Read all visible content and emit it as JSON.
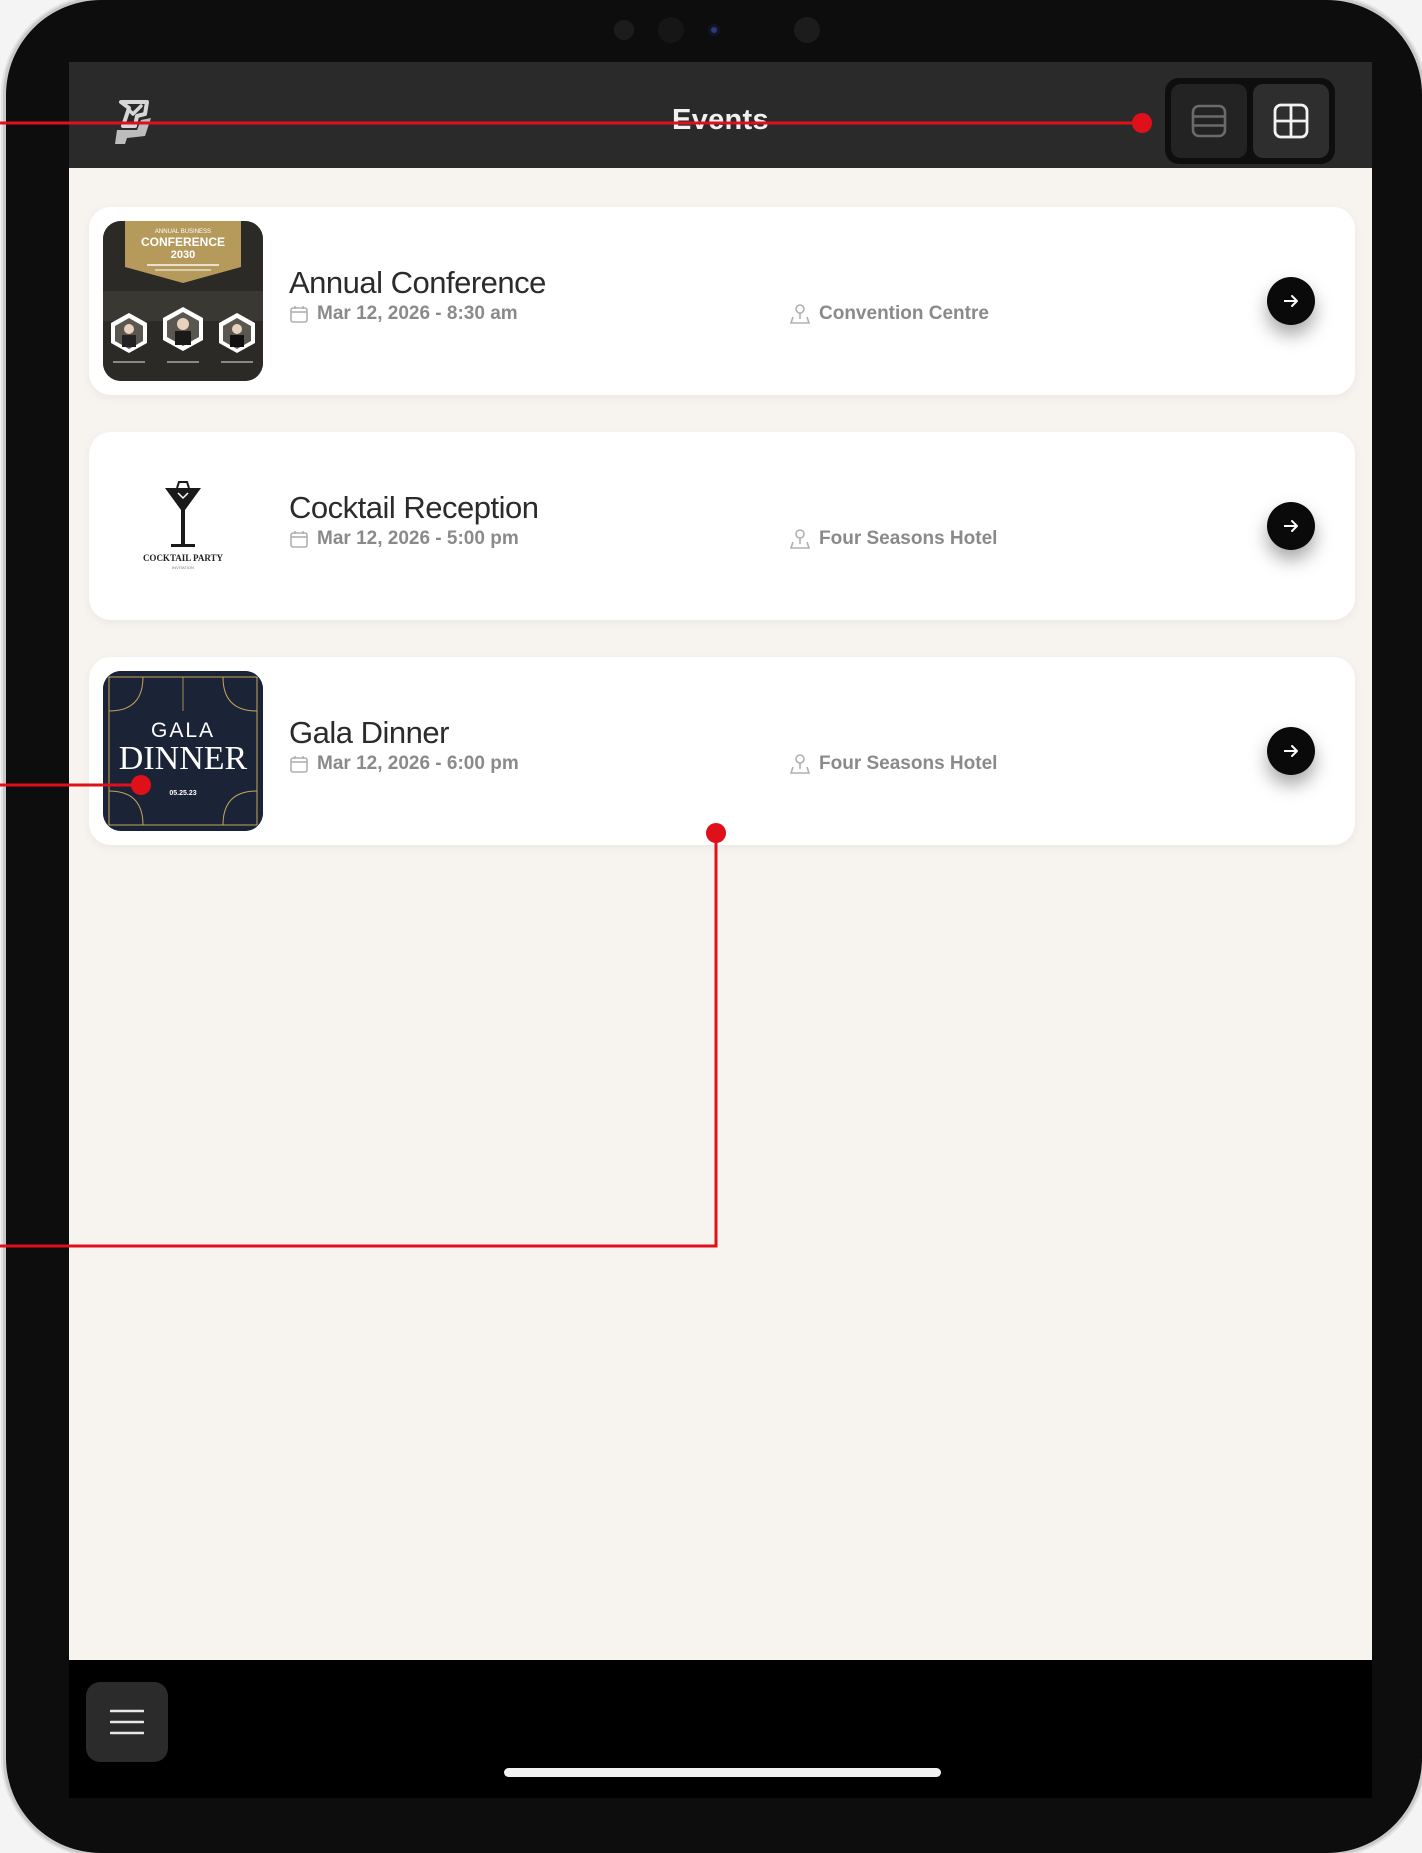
{
  "header": {
    "title": "Events",
    "view_toggle": {
      "list_icon": "list-rows-icon",
      "grid_icon": "grid-icon",
      "selected": "grid"
    }
  },
  "events": [
    {
      "title": "Annual Conference",
      "date": "Mar 12, 2026 - 8:30 am",
      "venue": "Convention Centre",
      "thumbnail": {
        "kicker": "ANNUAL BUSINESS",
        "heading": "CONFERENCE",
        "year": "2030"
      }
    },
    {
      "title": "Cocktail Reception",
      "date": "Mar 12, 2026 - 5:00 pm",
      "venue": "Four Seasons Hotel",
      "thumbnail": {
        "heading": "COCKTAIL PARTY",
        "sub": "INVITATION"
      }
    },
    {
      "title": "Gala Dinner",
      "date": "Mar 12, 2026 - 6:00 pm",
      "venue": "Four Seasons Hotel",
      "thumbnail": {
        "line1": "GALA",
        "line2": "DINNER",
        "date": "05.25.23"
      }
    }
  ],
  "icons": {
    "date": "calendar-icon",
    "venue": "location-pin-icon",
    "open": "arrow-right-icon",
    "menu": "hamburger-menu-icon",
    "logo": "app-logo-icon"
  },
  "colors": {
    "header_bg": "#2a2a2a",
    "screen_bg": "#f7f4f0",
    "card_bg": "#ffffff",
    "accent_black": "#0a0a0a",
    "annotation_red": "#e0101a",
    "gala_navy": "#1b2337",
    "gala_gold": "#c9a45a"
  }
}
